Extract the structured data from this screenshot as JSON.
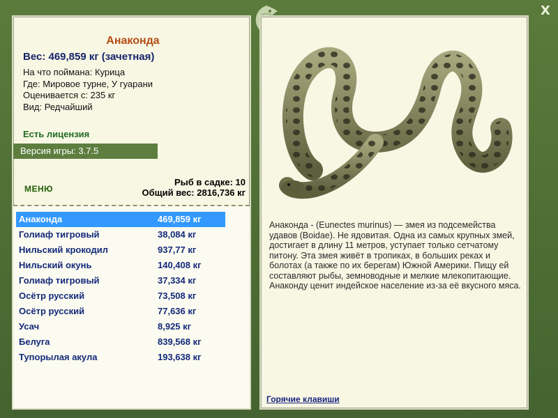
{
  "window": {
    "close_label": "X"
  },
  "left": {
    "fish_name": "Анаконда",
    "weight_line": "Вес: 469,859 кг (зачетная)",
    "info": [
      "На что поймана: Курица",
      "Где: Мировое турне, У гуарани",
      "Оценивается с: 235 кг",
      "Вид: Редчайший"
    ],
    "license": "Есть лицензия",
    "version": "Версия игры: 3.7.5",
    "menu_label": "МЕНЮ",
    "fish_in_keepnet": "Рыб в садке: 10",
    "total_weight": "Общий вес: 2816,736 кг"
  },
  "catch_list": [
    {
      "name": "Анаконда",
      "weight": "469,859 кг",
      "selected": true
    },
    {
      "name": "Голиаф тигровый",
      "weight": "38,084 кг"
    },
    {
      "name": "Нильский крокодил",
      "weight": "937,77 кг"
    },
    {
      "name": "Нильский окунь",
      "weight": "140,408 кг"
    },
    {
      "name": "Голиаф тигровый",
      "weight": "37,334 кг"
    },
    {
      "name": "Осётр русский",
      "weight": "73,508 кг"
    },
    {
      "name": "Осётр русский",
      "weight": "77,636 кг"
    },
    {
      "name": "Усач",
      "weight": "8,925 кг"
    },
    {
      "name": "Белуга",
      "weight": "839,568 кг"
    },
    {
      "name": "Тупорылая акула",
      "weight": "193,638 кг"
    }
  ],
  "right": {
    "description": "Анаконда - (Eunectes murinus) — змея из подсемейства удавов (Boidae). Не ядовитая. Одна из самых крупных змей, достигает в длину 11 метров, уступает только сетчатому питону. Эта змея живёт в тропиках, в больших реках и болотах (а также по их берегам) Южной Америки. Пищу ей составляют рыбы, земноводные и мелкие млекопитающие. Анаконду ценит индейское население из-за её вкусного мяса.",
    "hotkeys_label": "Горячие клавиши"
  },
  "colors": {
    "frame": "#4f6d34",
    "panel": "#f8f7e4",
    "title": "#b44c14",
    "link": "#1a237e",
    "selected": "#3399ff"
  },
  "icons": {
    "logo": "fish-logo-icon",
    "close": "close-icon",
    "image": "anaconda-image"
  }
}
